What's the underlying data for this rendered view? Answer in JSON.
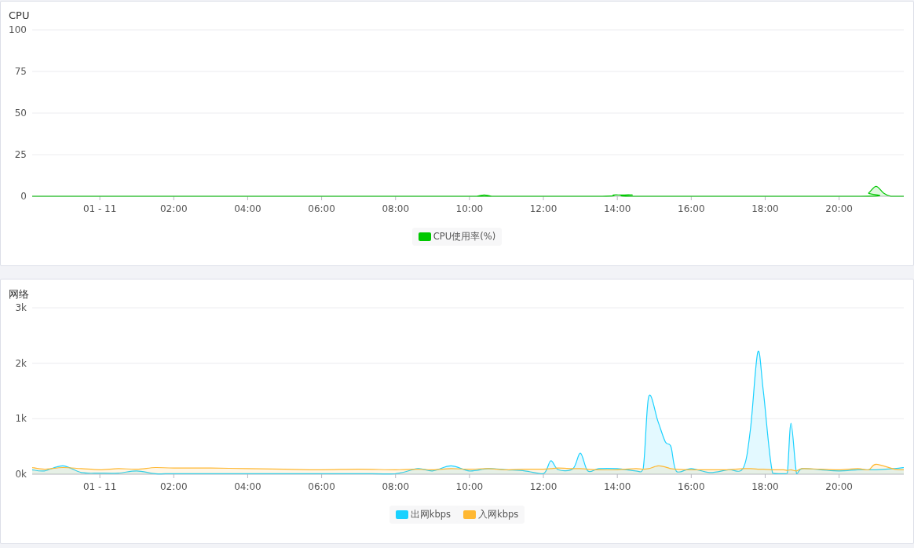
{
  "panels": [
    {
      "title": "CPU",
      "chart_data": {
        "type": "area",
        "grid": true,
        "x": [
          -1.83,
          10,
          10.2,
          10.4,
          10.6,
          10.8,
          13.6,
          13.9,
          14.1,
          14.4,
          14.6,
          20.6,
          20.8,
          21.0,
          21.2,
          21.4,
          21.75
        ],
        "xlim": [
          -1.83,
          21.75
        ],
        "ylim": [
          0,
          100
        ],
        "xticks": [
          {
            "value": 0,
            "label": "01 - 11"
          },
          {
            "value": 2,
            "label": "02:00"
          },
          {
            "value": 4,
            "label": "04:00"
          },
          {
            "value": 6,
            "label": "06:00"
          },
          {
            "value": 8,
            "label": "08:00"
          },
          {
            "value": 10,
            "label": "10:00"
          },
          {
            "value": 12,
            "label": "12:00"
          },
          {
            "value": 14,
            "label": "14:00"
          },
          {
            "value": 16,
            "label": "16:00"
          },
          {
            "value": 18,
            "label": "18:00"
          },
          {
            "value": 20,
            "label": "20:00"
          }
        ],
        "yticks": [
          0,
          25,
          50,
          75,
          100
        ],
        "series": [
          {
            "name": "CPU使用率(%)",
            "color": "#00c800",
            "values": [
              0,
              0,
              0,
              0.8,
              0,
              0,
              0,
              0.8,
              0.8,
              0.8,
              0,
              0,
              2,
              6,
              2,
              0,
              0
            ]
          }
        ]
      }
    },
    {
      "title": "网络",
      "chart_data": {
        "type": "area",
        "grid": true,
        "x": [
          -1.83,
          -1.5,
          -1,
          -0.5,
          0,
          0.5,
          1,
          1.5,
          2,
          3,
          4,
          5,
          6,
          7,
          8,
          8.6,
          9,
          9.5,
          10,
          10.5,
          11,
          11.5,
          12,
          12.2,
          12.4,
          12.8,
          13,
          13.2,
          13.5,
          14,
          14.5,
          14.7,
          14.85,
          15.1,
          15.3,
          15.45,
          15.6,
          16,
          16.5,
          17,
          17.4,
          17.6,
          17.8,
          17.95,
          18.2,
          18.5,
          18.6,
          18.7,
          18.85,
          19,
          19.5,
          20,
          20.5,
          20.8,
          21,
          21.5,
          21.75
        ],
        "xlim": [
          -1.83,
          21.75
        ],
        "ylim": [
          0,
          3000
        ],
        "xticks": [
          {
            "value": 0,
            "label": "01 - 11"
          },
          {
            "value": 2,
            "label": "02:00"
          },
          {
            "value": 4,
            "label": "04:00"
          },
          {
            "value": 6,
            "label": "06:00"
          },
          {
            "value": 8,
            "label": "08:00"
          },
          {
            "value": 10,
            "label": "10:00"
          },
          {
            "value": 12,
            "label": "12:00"
          },
          {
            "value": 14,
            "label": "14:00"
          },
          {
            "value": 16,
            "label": "16:00"
          },
          {
            "value": 18,
            "label": "18:00"
          },
          {
            "value": 20,
            "label": "20:00"
          }
        ],
        "yticks": [
          {
            "value": 0,
            "label": "0k"
          },
          {
            "value": 1000,
            "label": "1k"
          },
          {
            "value": 2000,
            "label": "2k"
          },
          {
            "value": 3000,
            "label": "3k"
          }
        ],
        "series": [
          {
            "name": "出网kbps",
            "color": "#1ad1ff",
            "values": [
              80,
              60,
              150,
              30,
              20,
              20,
              60,
              10,
              10,
              10,
              10,
              10,
              10,
              10,
              10,
              100,
              60,
              150,
              60,
              100,
              80,
              60,
              10,
              240,
              80,
              100,
              380,
              60,
              100,
              100,
              60,
              100,
              1400,
              950,
              580,
              500,
              50,
              100,
              30,
              80,
              100,
              800,
              2200,
              1500,
              20,
              10,
              20,
              920,
              10,
              100,
              80,
              60,
              80,
              80,
              80,
              100,
              120
            ]
          },
          {
            "name": "入网kbps",
            "color": "#ffb833",
            "values": [
              120,
              90,
              120,
              100,
              80,
              100,
              90,
              120,
              110,
              110,
              100,
              90,
              80,
              90,
              80,
              90,
              80,
              100,
              90,
              100,
              80,
              90,
              90,
              100,
              110,
              100,
              100,
              90,
              80,
              80,
              100,
              90,
              100,
              150,
              130,
              100,
              90,
              80,
              80,
              80,
              100,
              100,
              90,
              90,
              80,
              80,
              70,
              80,
              60,
              100,
              90,
              80,
              100,
              80,
              180,
              90,
              80
            ]
          }
        ]
      }
    }
  ]
}
